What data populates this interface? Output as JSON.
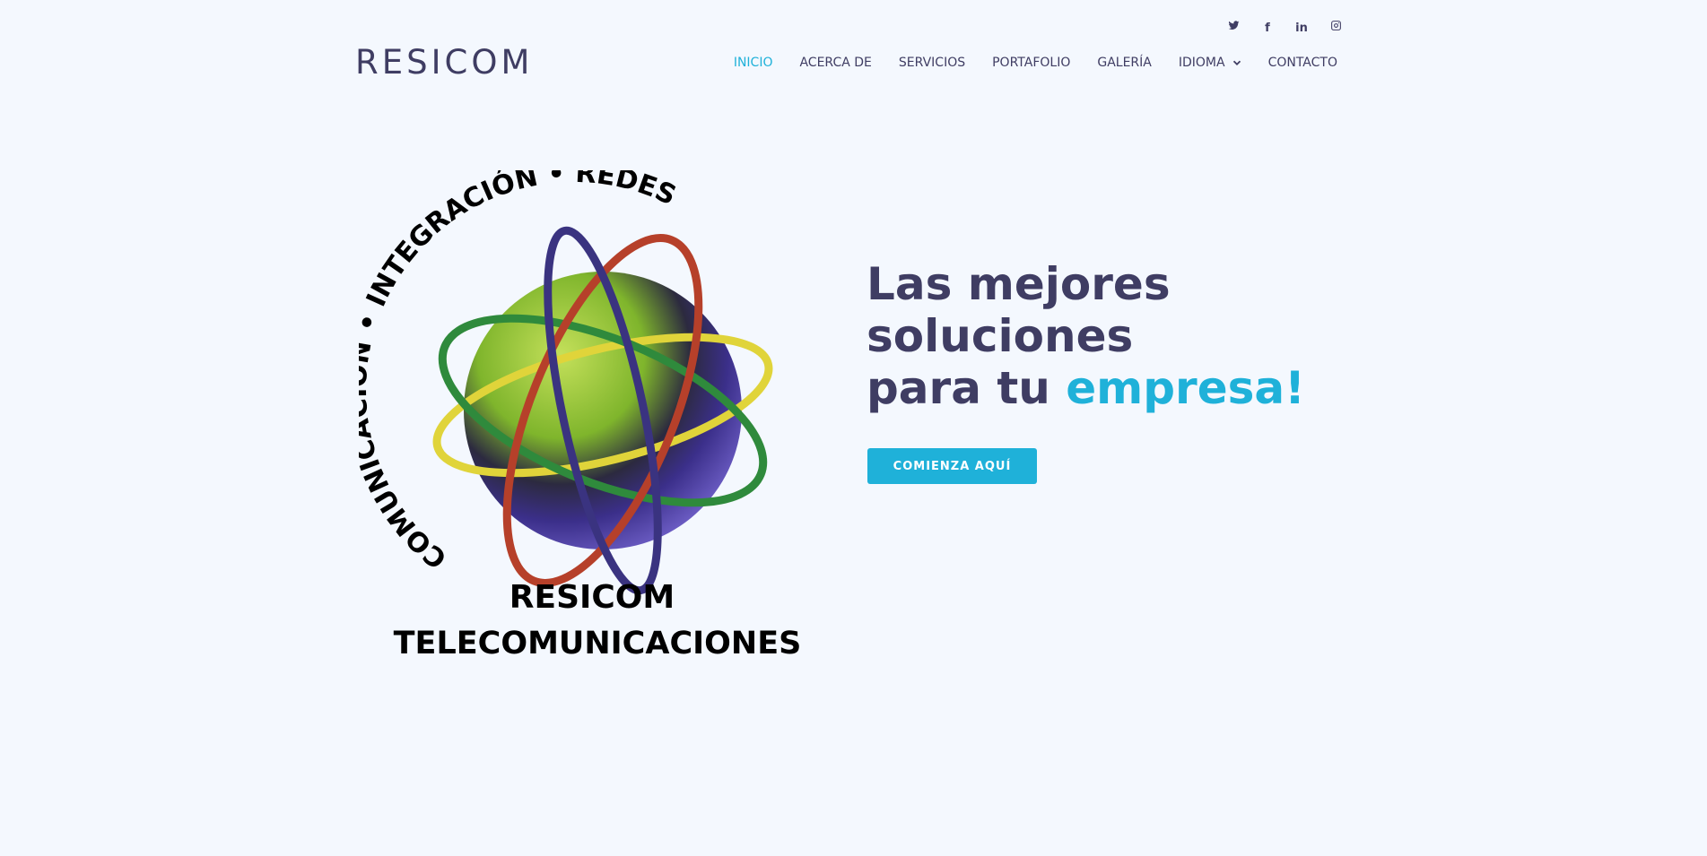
{
  "header": {
    "logo": "RESICOM",
    "nav": [
      {
        "label": "INICIO"
      },
      {
        "label": "ACERCA DE"
      },
      {
        "label": "SERVICIOS"
      },
      {
        "label": "PORTAFOLIO"
      },
      {
        "label": "GALERÍA"
      },
      {
        "label": "IDIOMA"
      },
      {
        "label": "CONTACTO"
      }
    ],
    "social": [
      {
        "icon": "twitter-icon"
      },
      {
        "icon": "facebook-icon",
        "glyph": "f"
      },
      {
        "icon": "linkedin-icon",
        "glyph": "in"
      },
      {
        "icon": "instagram-icon"
      }
    ]
  },
  "hero": {
    "graphic": {
      "arc_text": "COMUNICACIÓN • INTEGRACIÓN • REDES",
      "line1": "RESICOM",
      "line2": "TELECOMUNICACIONES"
    },
    "headline": {
      "line1": "Las mejores",
      "line2": "soluciones",
      "line3_prefix": "para tu ",
      "line3_accent": "empresa!"
    },
    "cta_label": "COMIENZA AQUÍ"
  },
  "colors": {
    "background": "#f4f8fe",
    "text": "#3f3d63",
    "accent": "#1fb1d9"
  }
}
